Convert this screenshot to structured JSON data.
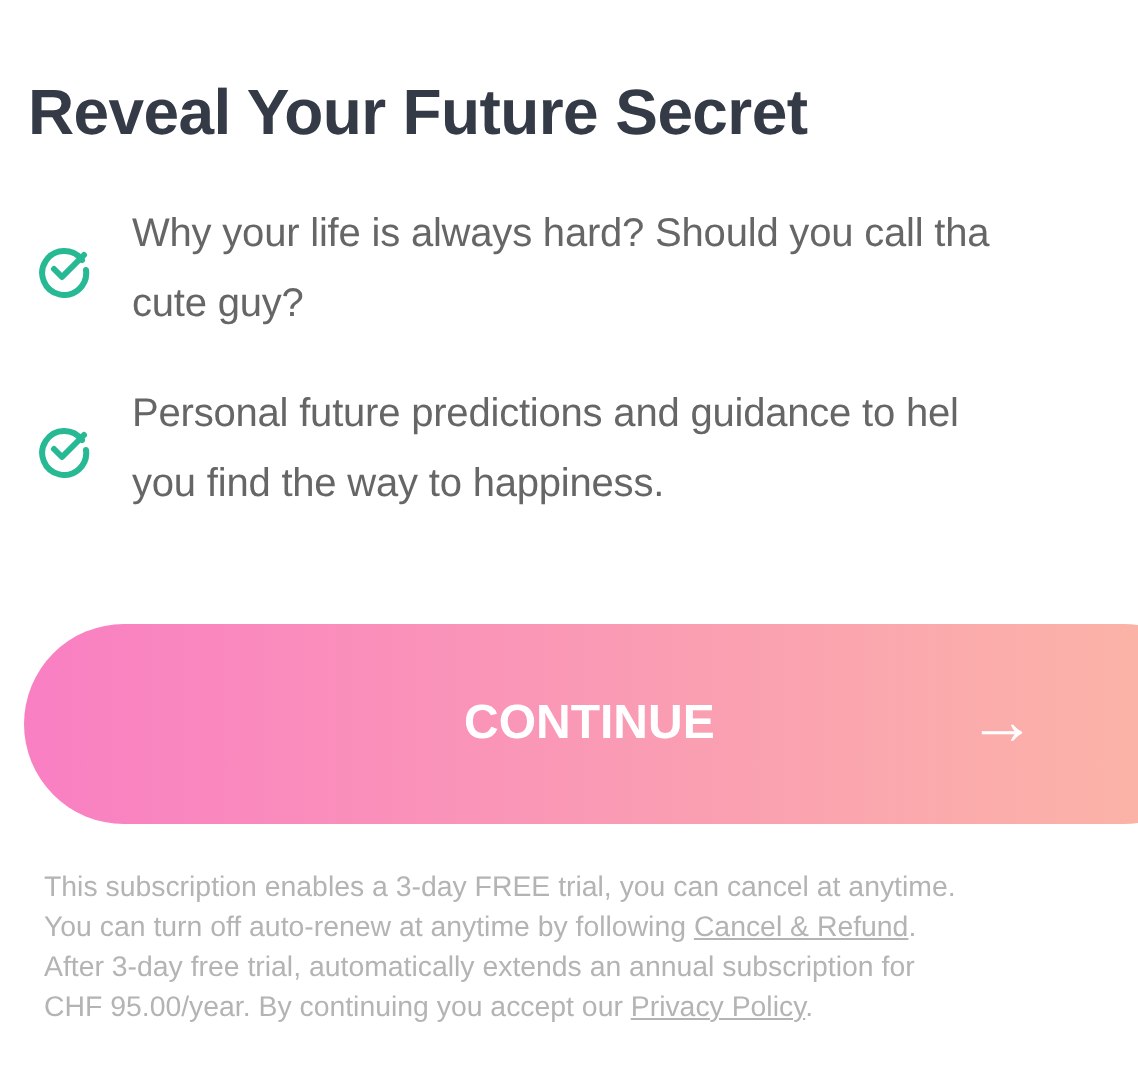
{
  "title": "Reveal Your Future Secret",
  "features": [
    {
      "lines": [
        "Why your life is always hard? Should you call tha",
        "cute guy?"
      ]
    },
    {
      "lines": [
        "Personal future predictions and guidance to hel",
        "you find the way to happiness."
      ]
    }
  ],
  "continue_button": {
    "label": "CONTINUE",
    "arrow": "→"
  },
  "disclaimer": [
    {
      "kind": "text",
      "text": "This subscription enables a 3-day FREE trial, you can cancel at anytime.\nYou can turn off auto-renew at anytime by following "
    },
    {
      "kind": "link",
      "text": "Cancel & Refund"
    },
    {
      "kind": "text",
      "text": ".\nAfter 3-day free trial, automatically extends an annual subscription for\nCHF 95.00/year. By continuing you accept our "
    },
    {
      "kind": "link",
      "text": "Privacy Policy"
    },
    {
      "kind": "text",
      "text": "."
    }
  ]
}
